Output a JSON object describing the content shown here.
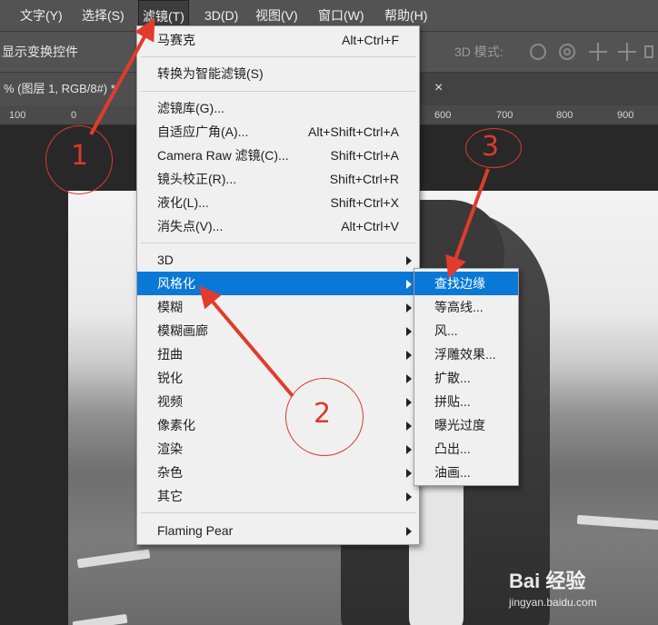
{
  "menubar": {
    "items": [
      "文字(Y)",
      "选择(S)",
      "滤镜(T)",
      "3D(D)",
      "视图(V)",
      "窗口(W)",
      "帮助(H)"
    ]
  },
  "options_bar": {
    "show_transform": "显示变换控件",
    "mode_3d": "3D 模式:"
  },
  "doc_tab": {
    "title": "% (图层 1, RGB/8#) *",
    "close": "×"
  },
  "ruler": {
    "ticks": [
      "100",
      "0",
      "600",
      "700",
      "800",
      "900"
    ]
  },
  "filter_menu": {
    "items": [
      {
        "label": "马赛克",
        "shortcut": "Alt+Ctrl+F"
      },
      {
        "label": "转换为智能滤镜(S)",
        "shortcut": ""
      },
      {
        "label": "滤镜库(G)...",
        "shortcut": ""
      },
      {
        "label": "自适应广角(A)...",
        "shortcut": "Alt+Shift+Ctrl+A"
      },
      {
        "label": "Camera Raw 滤镜(C)...",
        "shortcut": "Shift+Ctrl+A"
      },
      {
        "label": "镜头校正(R)...",
        "shortcut": "Shift+Ctrl+R"
      },
      {
        "label": "液化(L)...",
        "shortcut": "Shift+Ctrl+X"
      },
      {
        "label": "消失点(V)...",
        "shortcut": "Alt+Ctrl+V"
      },
      {
        "label": "3D",
        "shortcut": ""
      },
      {
        "label": "风格化",
        "shortcut": ""
      },
      {
        "label": "模糊",
        "shortcut": ""
      },
      {
        "label": "模糊画廊",
        "shortcut": ""
      },
      {
        "label": "扭曲",
        "shortcut": ""
      },
      {
        "label": "锐化",
        "shortcut": ""
      },
      {
        "label": "视频",
        "shortcut": ""
      },
      {
        "label": "像素化",
        "shortcut": ""
      },
      {
        "label": "渲染",
        "shortcut": ""
      },
      {
        "label": "杂色",
        "shortcut": ""
      },
      {
        "label": "其它",
        "shortcut": ""
      },
      {
        "label": "Flaming Pear",
        "shortcut": ""
      }
    ]
  },
  "stylize_submenu": {
    "items": [
      "查找边缘",
      "等高线...",
      "风...",
      "浮雕效果...",
      "扩散...",
      "拼贴...",
      "曝光过度",
      "凸出...",
      "油画..."
    ]
  },
  "annotations": {
    "n1": "1",
    "n2": "2",
    "n3": "3",
    "color": "#d93a2b"
  },
  "watermark": {
    "brand": "Bai 经验",
    "url": "jingyan.baidu.com"
  }
}
